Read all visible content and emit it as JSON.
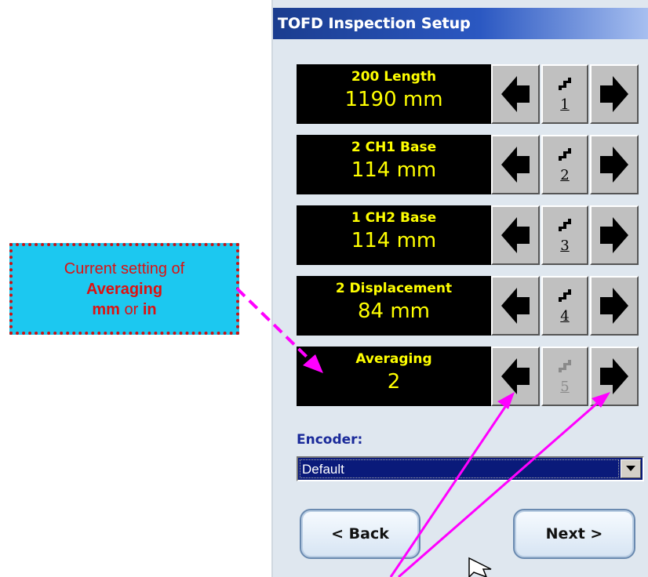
{
  "callout": {
    "line1": "Current setting of",
    "line2": "Averaging",
    "line3_a": "mm",
    "line3_b": " or ",
    "line3_c": "in"
  },
  "window": {
    "title": "TOFD Inspection Setup"
  },
  "rows": [
    {
      "label": "200 Length",
      "value": "1190 mm",
      "step": "1",
      "enabled": true
    },
    {
      "label": "2 CH1 Base",
      "value": "114 mm",
      "step": "2",
      "enabled": true
    },
    {
      "label": "1 CH2 Base",
      "value": "114 mm",
      "step": "3",
      "enabled": true
    },
    {
      "label": "2 Displacement",
      "value": "84 mm",
      "step": "4",
      "enabled": true
    },
    {
      "label": "Averaging",
      "value": "2",
      "step": "5",
      "enabled": false
    }
  ],
  "encoder": {
    "label": "Encoder:",
    "selected": "Default"
  },
  "buttons": {
    "back": "< Back",
    "next": "Next >"
  },
  "colors": {
    "display_bg": "#000000",
    "display_text": "#ffff00",
    "callout_bg": "#1cc8f0",
    "callout_text": "#dd1111",
    "annotation_arrows": "#ff00ff"
  },
  "icons": {
    "left": "left-arrow-icon",
    "right": "right-arrow-icon",
    "step": "step-icon",
    "dropdown": "dropdown-arrow-icon",
    "cursor": "mouse-cursor-icon"
  }
}
